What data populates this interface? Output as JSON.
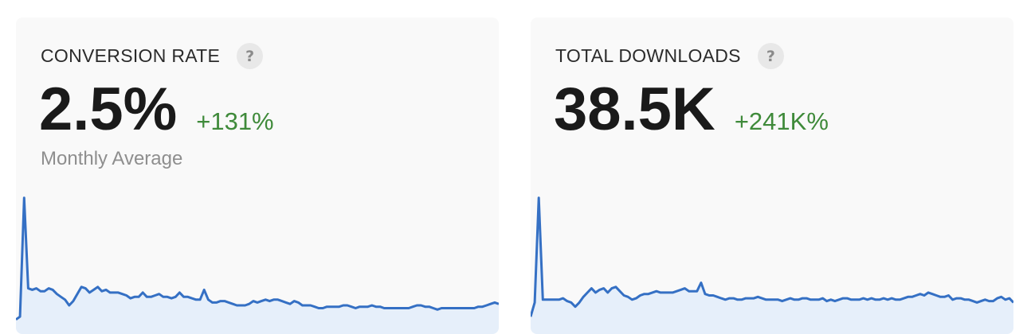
{
  "cards": [
    {
      "title": "CONVERSION RATE",
      "help_icon": "question-mark-icon",
      "value": "2.5%",
      "change": "+131%",
      "subtitle": "Monthly Average",
      "colors": {
        "line": "#3570c4",
        "fill": "#e6effa",
        "change": "#3f8a3a"
      },
      "trend": [
        0.08,
        0.1,
        0.94,
        0.3,
        0.29,
        0.3,
        0.28,
        0.28,
        0.3,
        0.29,
        0.26,
        0.24,
        0.22,
        0.18,
        0.21,
        0.26,
        0.31,
        0.3,
        0.27,
        0.29,
        0.31,
        0.28,
        0.29,
        0.27,
        0.27,
        0.27,
        0.26,
        0.25,
        0.23,
        0.24,
        0.24,
        0.27,
        0.24,
        0.24,
        0.25,
        0.26,
        0.24,
        0.24,
        0.23,
        0.24,
        0.27,
        0.24,
        0.24,
        0.23,
        0.22,
        0.22,
        0.29,
        0.22,
        0.2,
        0.2,
        0.21,
        0.21,
        0.2,
        0.19,
        0.18,
        0.18,
        0.18,
        0.19,
        0.21,
        0.2,
        0.21,
        0.22,
        0.21,
        0.22,
        0.22,
        0.21,
        0.2,
        0.19,
        0.21,
        0.2,
        0.18,
        0.18,
        0.18,
        0.17,
        0.16,
        0.16,
        0.17,
        0.17,
        0.17,
        0.17,
        0.18,
        0.18,
        0.17,
        0.16,
        0.17,
        0.17,
        0.17,
        0.18,
        0.17,
        0.17,
        0.16,
        0.16,
        0.16,
        0.16,
        0.16,
        0.16,
        0.16,
        0.17,
        0.18,
        0.18,
        0.17,
        0.17,
        0.16,
        0.15,
        0.16,
        0.16,
        0.16,
        0.16,
        0.16,
        0.16,
        0.16,
        0.16,
        0.16,
        0.17,
        0.17,
        0.18,
        0.19,
        0.2,
        0.19
      ]
    },
    {
      "title": "TOTAL DOWNLOADS",
      "help_icon": "question-mark-icon",
      "value": "38.5K",
      "change": "+241K%",
      "subtitle": "",
      "colors": {
        "line": "#3570c4",
        "fill": "#e6effa",
        "change": "#3f8a3a"
      },
      "trend": [
        0.1,
        0.2,
        0.94,
        0.22,
        0.22,
        0.22,
        0.22,
        0.22,
        0.23,
        0.21,
        0.2,
        0.17,
        0.2,
        0.24,
        0.27,
        0.3,
        0.27,
        0.29,
        0.3,
        0.27,
        0.3,
        0.31,
        0.28,
        0.25,
        0.24,
        0.22,
        0.23,
        0.25,
        0.26,
        0.26,
        0.27,
        0.28,
        0.27,
        0.27,
        0.27,
        0.27,
        0.28,
        0.29,
        0.3,
        0.28,
        0.28,
        0.28,
        0.34,
        0.26,
        0.25,
        0.25,
        0.24,
        0.23,
        0.22,
        0.23,
        0.23,
        0.22,
        0.22,
        0.23,
        0.23,
        0.23,
        0.24,
        0.23,
        0.22,
        0.22,
        0.22,
        0.22,
        0.21,
        0.22,
        0.23,
        0.22,
        0.22,
        0.23,
        0.23,
        0.22,
        0.22,
        0.22,
        0.23,
        0.21,
        0.22,
        0.21,
        0.22,
        0.23,
        0.23,
        0.22,
        0.22,
        0.22,
        0.23,
        0.22,
        0.23,
        0.22,
        0.22,
        0.23,
        0.22,
        0.23,
        0.22,
        0.22,
        0.23,
        0.24,
        0.24,
        0.25,
        0.26,
        0.25,
        0.27,
        0.26,
        0.25,
        0.24,
        0.24,
        0.25,
        0.22,
        0.23,
        0.23,
        0.22,
        0.22,
        0.21,
        0.2,
        0.21,
        0.22,
        0.21,
        0.21,
        0.23,
        0.24,
        0.22,
        0.23,
        0.2
      ]
    }
  ]
}
